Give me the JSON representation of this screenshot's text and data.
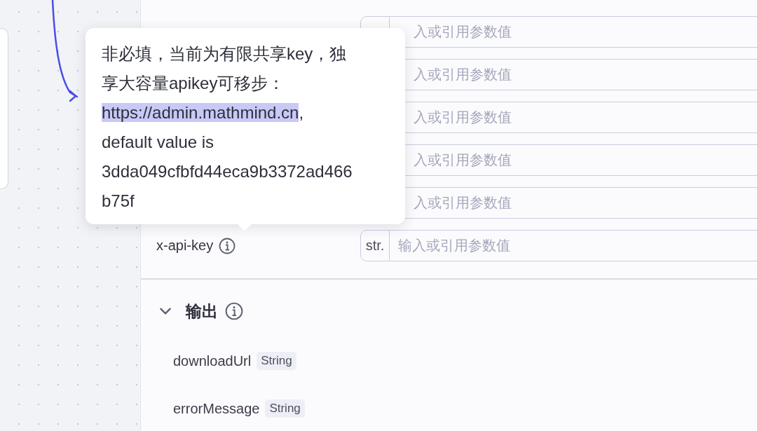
{
  "inputs": {
    "rows": [
      {
        "kind": "peeking",
        "placeholder": "入或引用参数值"
      },
      {
        "kind": "covered",
        "placeholder": "入或引用参数值"
      },
      {
        "kind": "covered",
        "placeholder": "入或引用参数值"
      },
      {
        "kind": "covered",
        "placeholder": "入或引用参数值"
      },
      {
        "kind": "covered",
        "placeholder": "入或引用参数值"
      },
      {
        "kind": "full",
        "label": "x-api-key",
        "type": "str.",
        "placeholder": "输入或引用参数值"
      }
    ]
  },
  "tooltip": {
    "segments": [
      {
        "text": "非必填，当前为有限共享key，独享大容量apikey可移步：",
        "highlighted": false
      },
      {
        "text": "https://admin.mathmind.cn",
        "highlighted": true
      },
      {
        "text": ", default value is 3dda049cfbfd44eca9b3372ad466b75f",
        "highlighted": false
      }
    ]
  },
  "output": {
    "title": "输出",
    "expanded": true,
    "fields": [
      {
        "name": "downloadUrl",
        "type": "String"
      },
      {
        "name": "errorMessage",
        "type": "String"
      }
    ]
  }
}
